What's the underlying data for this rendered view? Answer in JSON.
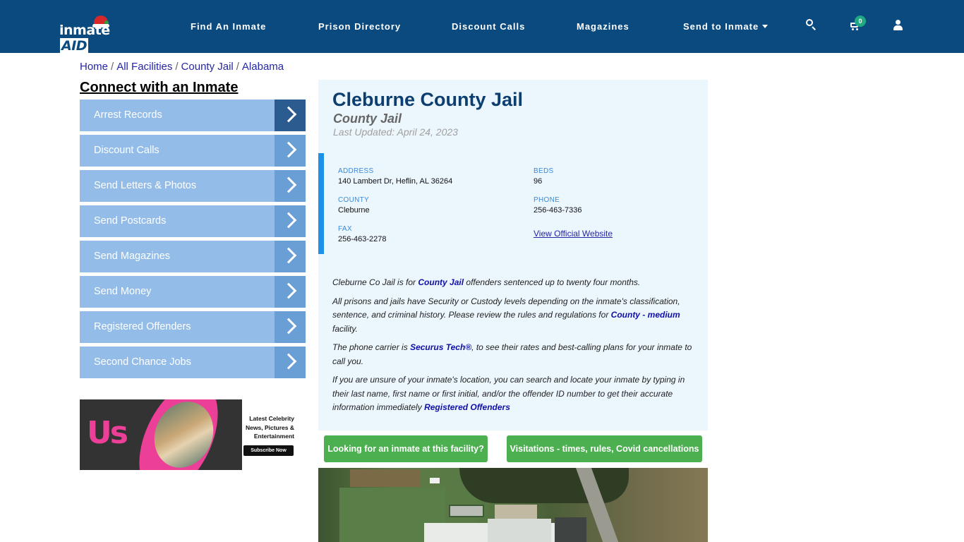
{
  "header": {
    "logo": {
      "text": "inmate",
      "accent": "AID"
    },
    "nav": [
      {
        "label": "Find An Inmate"
      },
      {
        "label": "Prison Directory"
      },
      {
        "label": "Discount Calls"
      },
      {
        "label": "Magazines"
      },
      {
        "label": "Send to Inmate",
        "has_dropdown": true
      }
    ],
    "icons": {
      "search": "search-icon",
      "cart": "cart-icon",
      "user": "user-icon"
    },
    "cart_count": "0",
    "colors": {
      "background": "#0b4a7e",
      "badge": "#20a882"
    }
  },
  "breadcrumb": [
    {
      "label": "Home"
    },
    {
      "label": "All Facilities"
    },
    {
      "label": "County Jail"
    },
    {
      "label": "Alabama"
    }
  ],
  "sidebar": {
    "title": "Connect with an Inmate",
    "items": [
      {
        "label": "Arrest Records",
        "active": true
      },
      {
        "label": "Discount Calls"
      },
      {
        "label": "Send Letters & Photos"
      },
      {
        "label": "Send Postcards"
      },
      {
        "label": "Send Magazines"
      },
      {
        "label": "Send Money"
      },
      {
        "label": "Registered Offenders"
      },
      {
        "label": "Second Chance Jobs"
      }
    ],
    "ad": {
      "brand": "Us",
      "headline": "Latest Celebrity News, Pictures & Entertainment",
      "cta": "Subscribe Now"
    }
  },
  "facility": {
    "name": "Cleburne County Jail",
    "type": "County Jail",
    "last_updated": "Last Updated: April 24, 2023",
    "fields": {
      "address_label": "ADDRESS",
      "address": "140 Lambert Dr, Heflin, AL 36264",
      "beds_label": "BEDS",
      "beds": "96",
      "county_label": "COUNTY",
      "county": "Cleburne",
      "phone_label": "PHONE",
      "phone": "256-463-7336",
      "fax_label": "FAX",
      "fax": "256-463-2278",
      "website_link": "View Official Website"
    },
    "description": {
      "p1_a": "Cleburne Co Jail is for ",
      "p1_link": "County Jail",
      "p1_b": " offenders sentenced up to twenty four months.",
      "p2_a": "All prisons and jails have Security or Custody levels depending on the inmate's classification, sentence, and criminal history. Please review the rules and regulations for ",
      "p2_link": "County - medium",
      "p2_b": " facility.",
      "p3_a": "The phone carrier is ",
      "p3_link": "Securus Tech®",
      "p3_b": ", to see their rates and best-calling plans for your inmate to call you.",
      "p4_a": "If you are unsure of your inmate's location, you can search and locate your inmate by typing in their last name, first name or first initial, and/or the offender ID number to get their accurate information immediately ",
      "p4_link": "Registered Offenders"
    },
    "buttons": {
      "find_inmate": "Looking for an inmate at this facility?",
      "visitations": "Visitations - times, rules, Covid cancellations"
    },
    "colors": {
      "title": "#0c3e70",
      "card_bg": "#ecf6fd",
      "accent_bar": "#1e90e8",
      "button": "#4caf50"
    }
  }
}
